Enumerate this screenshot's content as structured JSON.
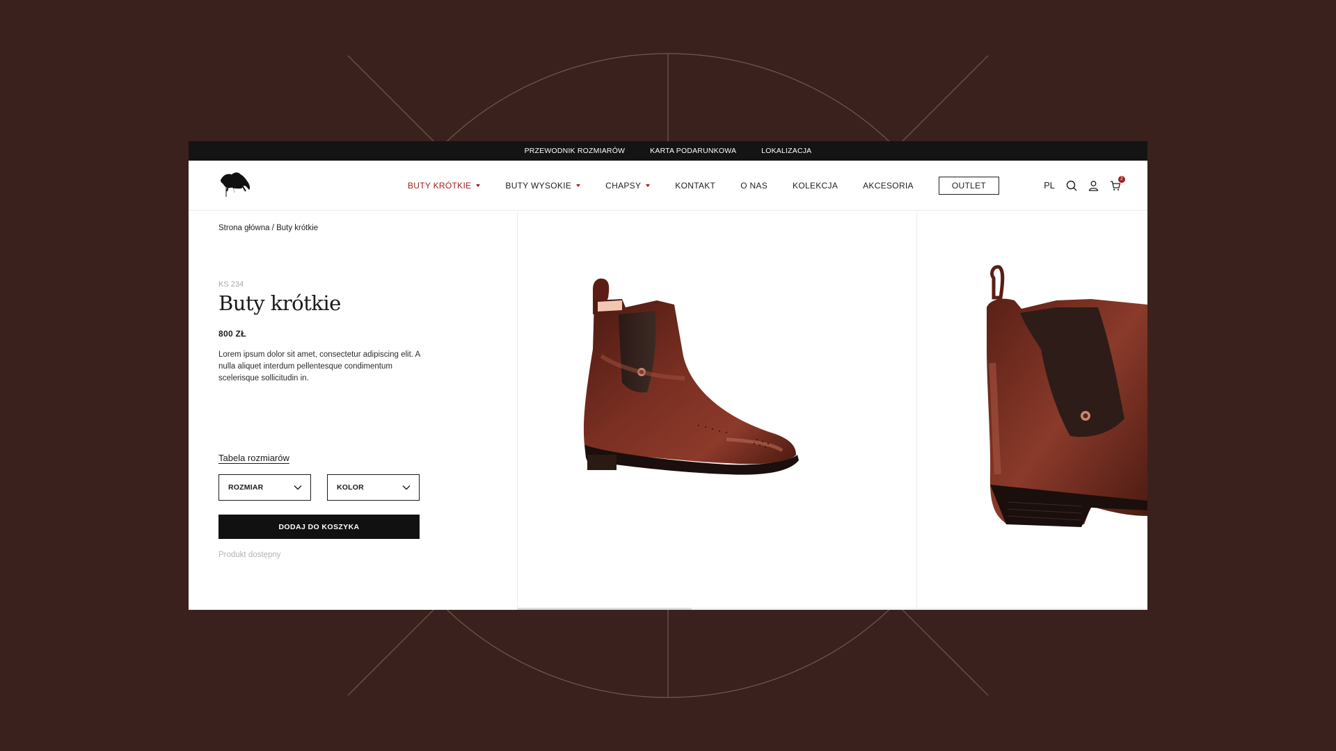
{
  "topbar": {
    "links": [
      "PRZEWODNIK ROZMIARÓW",
      "KARTA PODARUNKOWA",
      "LOKALIZACJA"
    ]
  },
  "header": {
    "logo_text": "Hippica",
    "nav": [
      {
        "label": "BUTY KRÓTKIE",
        "dropdown": true,
        "active": true
      },
      {
        "label": "BUTY WYSOKIE",
        "dropdown": true,
        "active": false
      },
      {
        "label": "CHAPSY",
        "dropdown": true,
        "active": false
      },
      {
        "label": "KONTAKT",
        "dropdown": false,
        "active": false
      },
      {
        "label": "O NAS",
        "dropdown": false,
        "active": false
      },
      {
        "label": "KOLEKCJA",
        "dropdown": false,
        "active": false
      },
      {
        "label": "AKCESORIA",
        "dropdown": false,
        "active": false
      }
    ],
    "outlet_label": "OUTLET",
    "language": "PL",
    "cart_count": "2",
    "icons": [
      "search-icon",
      "user-icon",
      "cart-icon"
    ]
  },
  "product": {
    "breadcrumb": "Strona główna / Buty krótkie",
    "sku": "KS 234",
    "title": "Buty krótkie",
    "price": "800 ZŁ",
    "description": "Lorem ipsum dolor sit amet, consectetur adipiscing elit. A nulla aliquet interdum pellentesque condimentum scelerisque sollicitudin in.",
    "size_table_link": "Tabela rozmiarów",
    "size_select": "ROZMIAR",
    "color_select": "KOLOR",
    "add_to_cart": "DODAJ DO KOSZYKA",
    "availability": "Produkt dostępny"
  },
  "colors": {
    "background": "#3b211d",
    "accent": "#9a1b1b",
    "button": "#111111",
    "leather": "#6b2a1c"
  }
}
